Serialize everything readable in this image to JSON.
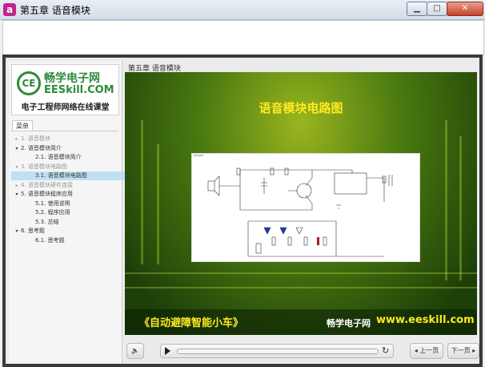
{
  "window": {
    "title": "第五章 语音模块",
    "app_icon": "a"
  },
  "sidebar": {
    "logo": {
      "cn": "畅学电子网",
      "en": "EESkill.COM",
      "slogan": "电子工程师网络在线课堂",
      "mark": "CE"
    },
    "menu_tab": "菜单",
    "items": [
      {
        "label": "1. 语音模块",
        "level": 0,
        "tri": "▸",
        "state": "dim"
      },
      {
        "label": "2. 语音模块简介",
        "level": 0,
        "tri": "▾",
        "state": "normal"
      },
      {
        "label": "2.1. 语音模块简介",
        "level": 1,
        "tri": "",
        "state": "normal"
      },
      {
        "label": "3. 语音模块电路图",
        "level": 0,
        "tri": "▾",
        "state": "dim"
      },
      {
        "label": "3.1. 语音模块电路图",
        "level": 1,
        "tri": "",
        "state": "active"
      },
      {
        "label": "4. 语音模块硬件连接",
        "level": 0,
        "tri": "▸",
        "state": "dim"
      },
      {
        "label": "5. 语音模块程序应用",
        "level": 0,
        "tri": "▾",
        "state": "normal"
      },
      {
        "label": "5.1. 使用说明",
        "level": 1,
        "tri": "",
        "state": "normal"
      },
      {
        "label": "5.2. 程序应用",
        "level": 1,
        "tri": "",
        "state": "normal"
      },
      {
        "label": "5.3. 总结",
        "level": 1,
        "tri": "",
        "state": "normal"
      },
      {
        "label": "6. 思考题",
        "level": 0,
        "tri": "▾",
        "state": "normal"
      },
      {
        "label": "6.1. 思考题",
        "level": 1,
        "tri": "",
        "state": "normal"
      }
    ]
  },
  "content": {
    "breadcrumb": "第五章 语音模块",
    "slide": {
      "title": "语音模块电路图",
      "slogan": "《自动避障智能小车》",
      "brand_cn": "畅学电子网",
      "brand_url": "www.eeskill.com"
    }
  },
  "controls": {
    "volume_icon": "🔈",
    "replay_icon": "↻",
    "prev_label": "◂ 上一页",
    "next_label": "下一页 ▸",
    "progress": 0
  },
  "colors": {
    "accent": "#ffea20",
    "brand_green": "#2e8b3a",
    "close_red": "#c6432a"
  }
}
